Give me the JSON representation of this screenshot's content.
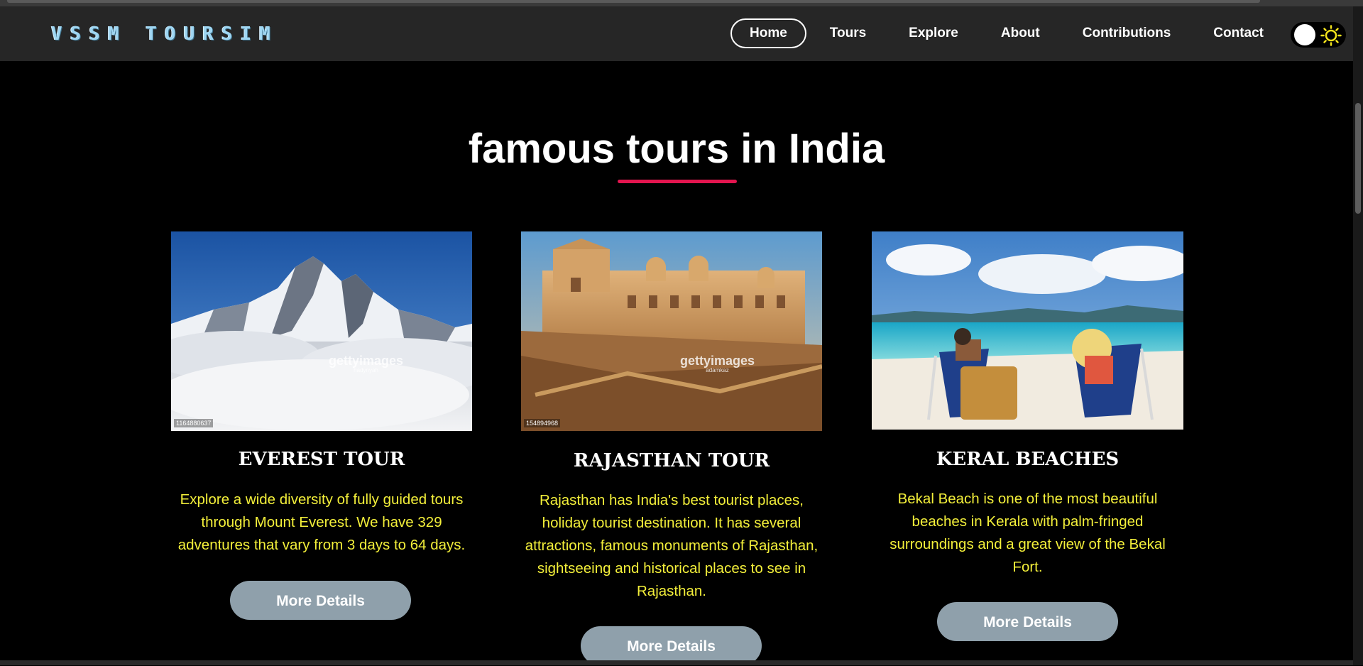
{
  "brand": {
    "logo": "VSSM TOURSIM"
  },
  "nav": {
    "items": [
      {
        "label": "Home",
        "active": true
      },
      {
        "label": "Tours"
      },
      {
        "label": "Explore"
      },
      {
        "label": "About"
      },
      {
        "label": "Contributions"
      },
      {
        "label": "Contact"
      }
    ]
  },
  "theme_toggle": {
    "icon": "sun-icon"
  },
  "section": {
    "title": "famous tours in India"
  },
  "cards": [
    {
      "title": "EVEREST TOUR",
      "description": "Explore a wide diversity of fully guided tours through Mount Everest. We have 329 adventures that vary from 3 days to 64 days.",
      "button": "More Details",
      "watermark": "gettyimages",
      "credit": "hadynyah",
      "image_id": "1164880637"
    },
    {
      "title": "RAJASTHAN TOUR",
      "description": "Rajasthan has India's best tourist places, holiday tourist destination. It has several attractions, famous monuments of Rajasthan, sightseeing and historical places to see in Rajasthan.",
      "button": "More Details",
      "watermark": "gettyimages",
      "credit": "adamkaz",
      "image_id": "154894968"
    },
    {
      "title": "KERAL BEACHES",
      "description": "Bekal Beach is one of the most beautiful beaches in Kerala with palm-fringed surroundings and a great view of the Bekal Fort.",
      "button": "More Details"
    }
  ],
  "colors": {
    "accent": "#e3154f",
    "card_text": "#f3ef3a",
    "button_bg": "#8fa0ab",
    "nav_bg": "#262626"
  }
}
